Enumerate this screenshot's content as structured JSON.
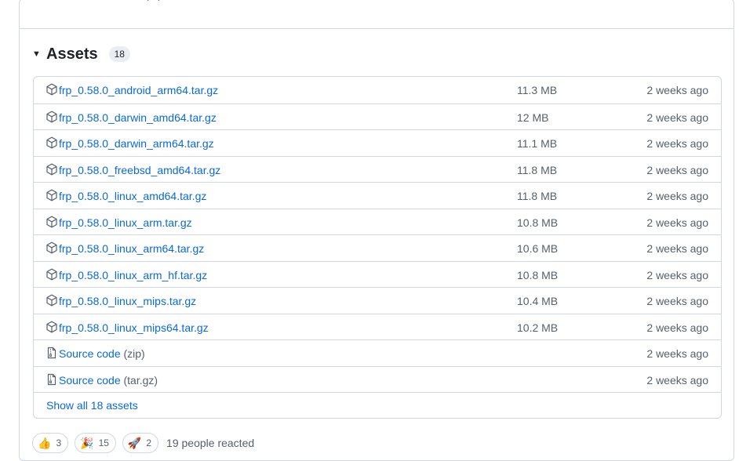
{
  "top_fragment": "(...)",
  "assets": {
    "title": "Assets",
    "count": "18",
    "files": [
      {
        "name": "frp_0.58.0_android_arm64.tar.gz",
        "size": "11.3 MB",
        "time": "2 weeks ago"
      },
      {
        "name": "frp_0.58.0_darwin_amd64.tar.gz",
        "size": "12 MB",
        "time": "2 weeks ago"
      },
      {
        "name": "frp_0.58.0_darwin_arm64.tar.gz",
        "size": "11.1 MB",
        "time": "2 weeks ago"
      },
      {
        "name": "frp_0.58.0_freebsd_amd64.tar.gz",
        "size": "11.8 MB",
        "time": "2 weeks ago"
      },
      {
        "name": "frp_0.58.0_linux_amd64.tar.gz",
        "size": "11.8 MB",
        "time": "2 weeks ago"
      },
      {
        "name": "frp_0.58.0_linux_arm.tar.gz",
        "size": "10.8 MB",
        "time": "2 weeks ago"
      },
      {
        "name": "frp_0.58.0_linux_arm64.tar.gz",
        "size": "10.6 MB",
        "time": "2 weeks ago"
      },
      {
        "name": "frp_0.58.0_linux_arm_hf.tar.gz",
        "size": "10.8 MB",
        "time": "2 weeks ago"
      },
      {
        "name": "frp_0.58.0_linux_mips.tar.gz",
        "size": "10.4 MB",
        "time": "2 weeks ago"
      },
      {
        "name": "frp_0.58.0_linux_mips64.tar.gz",
        "size": "10.2 MB",
        "time": "2 weeks ago"
      }
    ],
    "sources": [
      {
        "label": "Source code",
        "ext": "(zip)",
        "time": "2 weeks ago"
      },
      {
        "label": "Source code",
        "ext": "(tar.gz)",
        "time": "2 weeks ago"
      }
    ],
    "show_all": "Show all 18 assets"
  },
  "reactions": {
    "items": [
      {
        "icon": "thumbs-up-icon",
        "emoji": "👍",
        "count": "3"
      },
      {
        "icon": "party-popper-icon",
        "emoji": "🎉",
        "count": "15"
      },
      {
        "icon": "rocket-icon",
        "emoji": "🚀",
        "count": "2"
      }
    ],
    "summary": "19 people reacted"
  }
}
